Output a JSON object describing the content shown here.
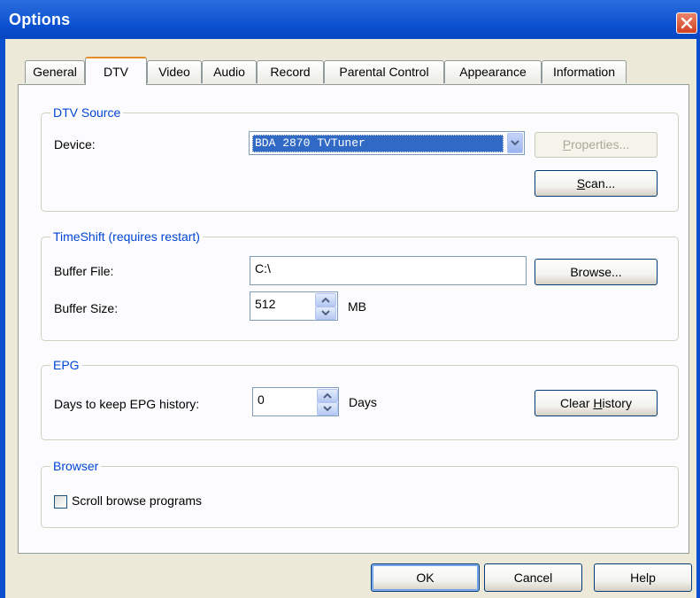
{
  "window": {
    "title": "Options"
  },
  "tabs": [
    {
      "label": "General"
    },
    {
      "label": "DTV"
    },
    {
      "label": "Video"
    },
    {
      "label": "Audio"
    },
    {
      "label": "Record"
    },
    {
      "label": "Parental Control"
    },
    {
      "label": "Appearance"
    },
    {
      "label": "Information"
    }
  ],
  "active_tab": "DTV",
  "dtv_source": {
    "legend": "DTV Source",
    "device_label": "Device:",
    "device_value": "BDA 2870 TVTuner",
    "properties_prefix": "P",
    "properties_rest": "roperties...",
    "scan_prefix": "S",
    "scan_rest": "can..."
  },
  "timeshift": {
    "legend": "TimeShift (requires restart)",
    "buffer_file_label": "Buffer File:",
    "buffer_file_value": "C:\\",
    "browse_label": "Browse...",
    "buffer_size_label": "Buffer Size:",
    "buffer_size_value": "512",
    "buffer_size_unit": "MB"
  },
  "epg": {
    "legend": "EPG",
    "days_label": "Days to keep EPG history:",
    "days_value": "0",
    "days_unit": "Days",
    "clear_prefix": "Clear ",
    "clear_accel": "H",
    "clear_rest": "istory"
  },
  "browser": {
    "legend": "Browser",
    "scroll_label": "Scroll browse programs",
    "scroll_checked": false
  },
  "footer": {
    "ok_label": "OK",
    "cancel_label": "Cancel",
    "help_label": "Help"
  },
  "colors": {
    "titlebar": "#0a4fcf",
    "legend_text": "#0046d5",
    "tab_highlight": "#e68b2c",
    "selection": "#316ac5"
  }
}
